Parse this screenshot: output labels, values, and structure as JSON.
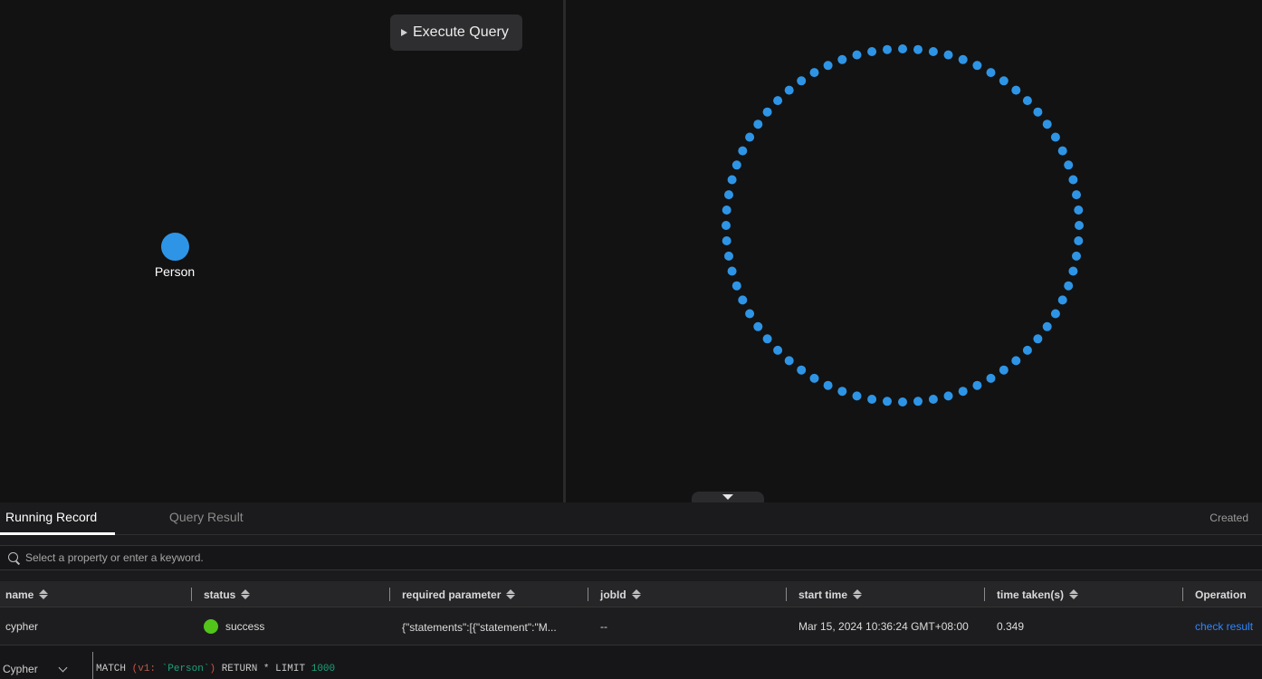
{
  "toolbar": {
    "execute_label": "Execute Query",
    "execute_icon": "play-icon"
  },
  "schema": {
    "node_label": "Person",
    "node_color": "#2e95e6"
  },
  "graph": {
    "node_count": 72,
    "node_color": "#2e95e6",
    "layout": "circle"
  },
  "panel": {
    "tabs": [
      {
        "label": "Running Record",
        "active": true
      },
      {
        "label": "Query Result",
        "active": false
      }
    ],
    "created_label": "Created",
    "search_placeholder": "Select a property or enter a keyword.",
    "columns": [
      "name",
      "status",
      "required parameter",
      "jobId",
      "start time",
      "time taken(s)",
      "Operation"
    ],
    "rows": [
      {
        "name": "cypher",
        "status": "success",
        "status_color": "#52c41a",
        "required_parameter": "{\"statements\":[{\"statement\":\"M...",
        "jobId": "--",
        "start_time": "Mar 15, 2024 10:36:24 GMT+08:00",
        "time_taken": "0.349",
        "operation": "check result"
      }
    ]
  },
  "editor": {
    "language": "Cypher",
    "query": {
      "match": "MATCH",
      "open": "(",
      "var": "v1:",
      "label": "`Person`",
      "close": ")",
      "ret": "RETURN * LIMIT",
      "limit": "1000"
    }
  },
  "colors": {
    "accent": "#2f86ff",
    "node": "#2e95e6",
    "success": "#52c41a"
  }
}
